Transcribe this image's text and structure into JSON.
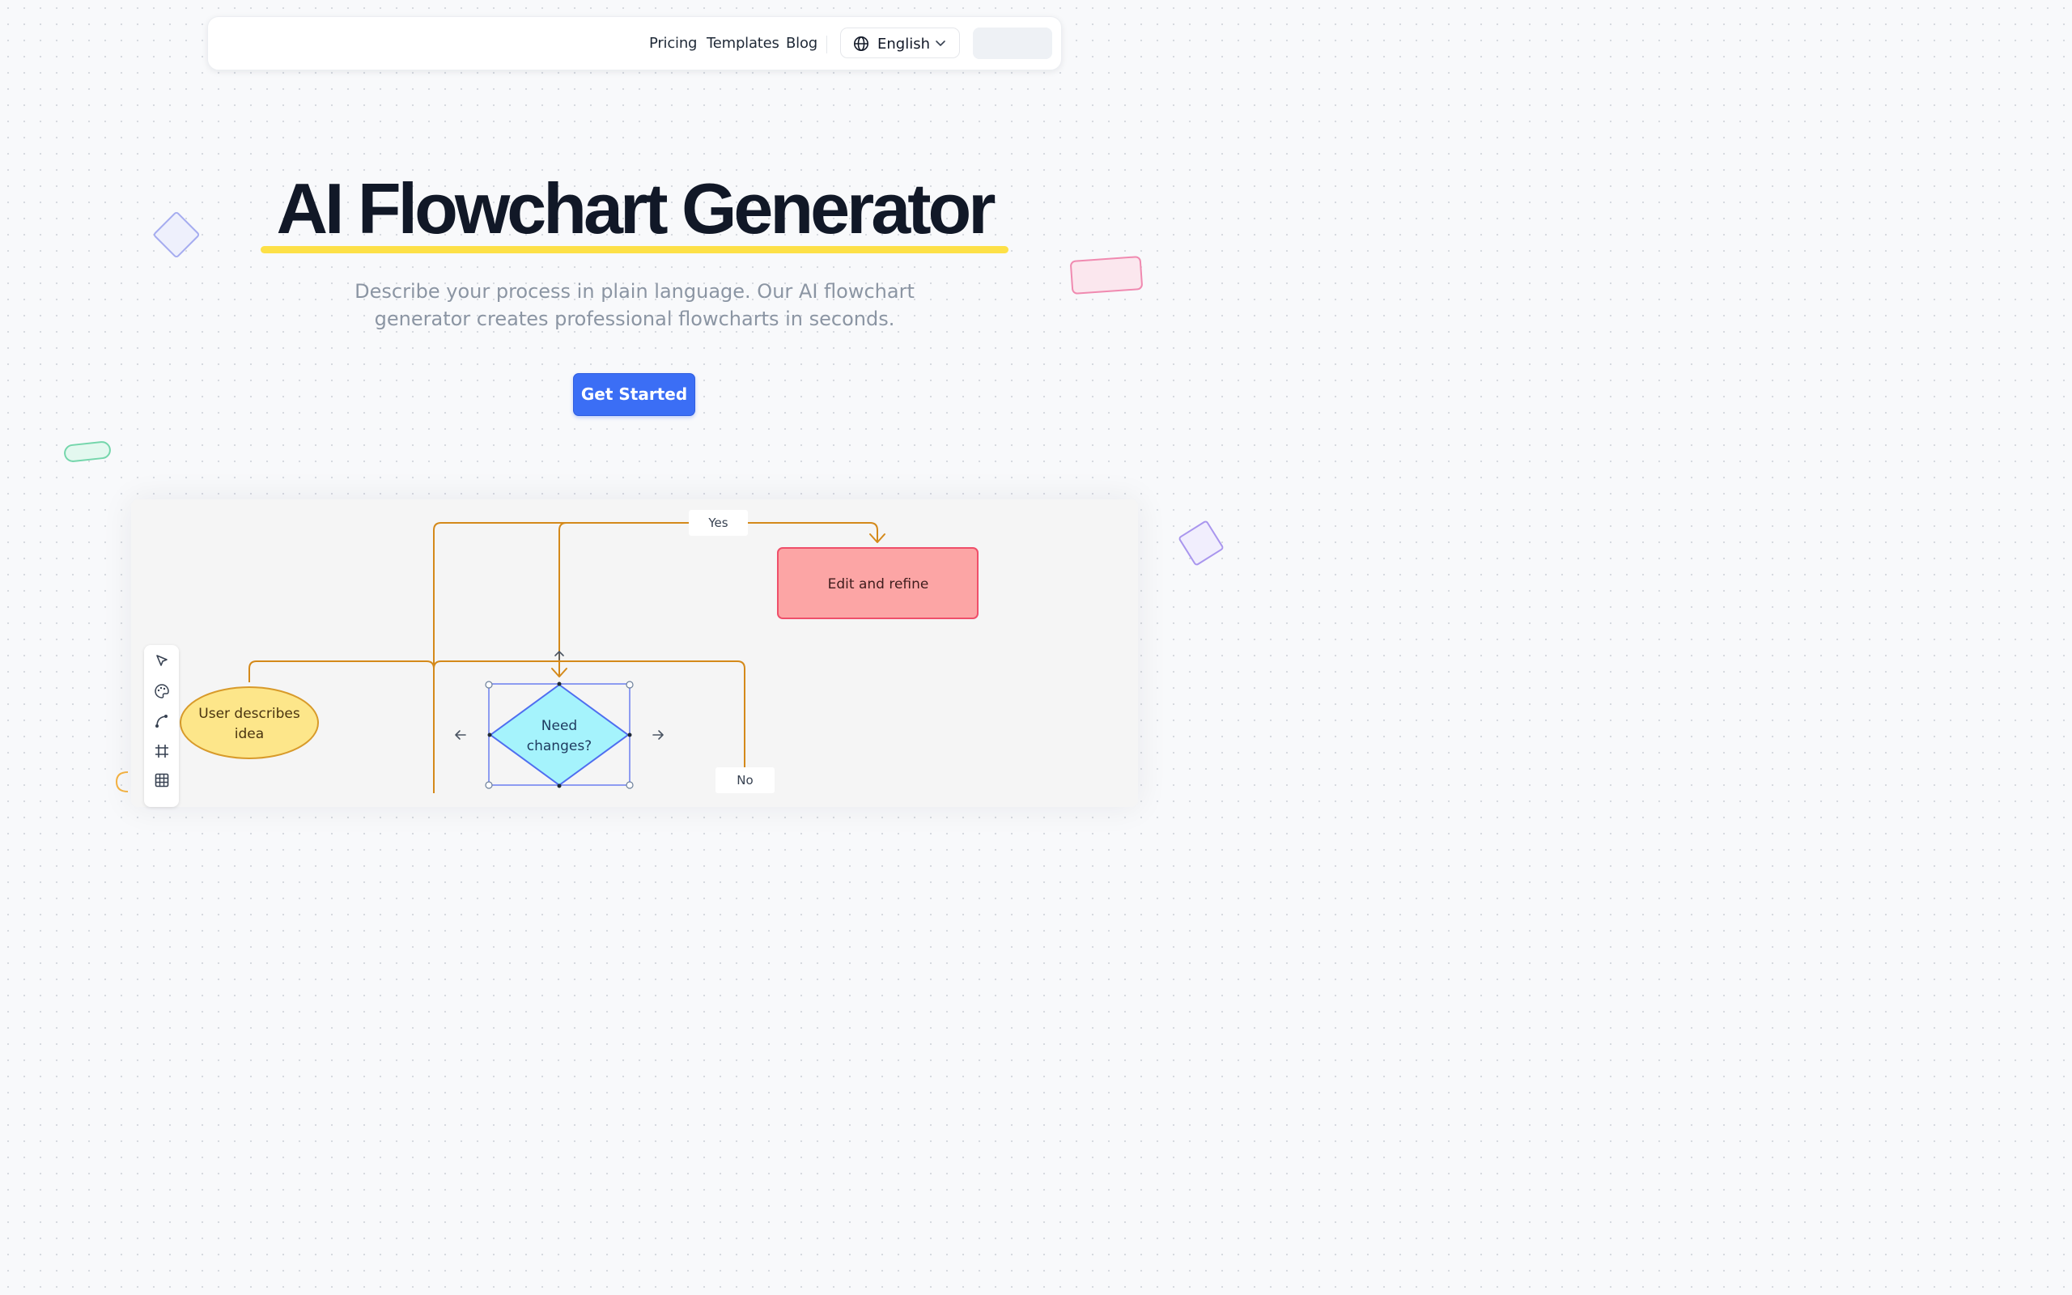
{
  "nav": {
    "links": [
      "Pricing",
      "Templates",
      "Blog"
    ],
    "language": "English"
  },
  "hero": {
    "title": "AI Flowchart Generator",
    "subtitle_line1": "Describe your process in plain language. Our AI flowchart",
    "subtitle_line2": "generator creates professional flowcharts in seconds.",
    "cta_label": "Get Started"
  },
  "flowchart": {
    "nodes": {
      "start": [
        "User describes",
        "idea"
      ],
      "decision": [
        "Need",
        "changes?"
      ],
      "edit": "Edit and refine"
    },
    "edge_labels": {
      "yes": "Yes",
      "no": "No"
    }
  },
  "toolbar": {
    "tools": [
      "pointer-icon",
      "palette-icon",
      "connector-icon",
      "frame-icon",
      "table-icon"
    ]
  },
  "colors": {
    "accent": "#3b6ef5",
    "highlight": "#fde047",
    "edge": "#d4891a",
    "start_node": "#fde68a",
    "decision_node": "#a5f3fc",
    "edit_node": "#fca5a5",
    "selection": "#6b7ff0"
  }
}
